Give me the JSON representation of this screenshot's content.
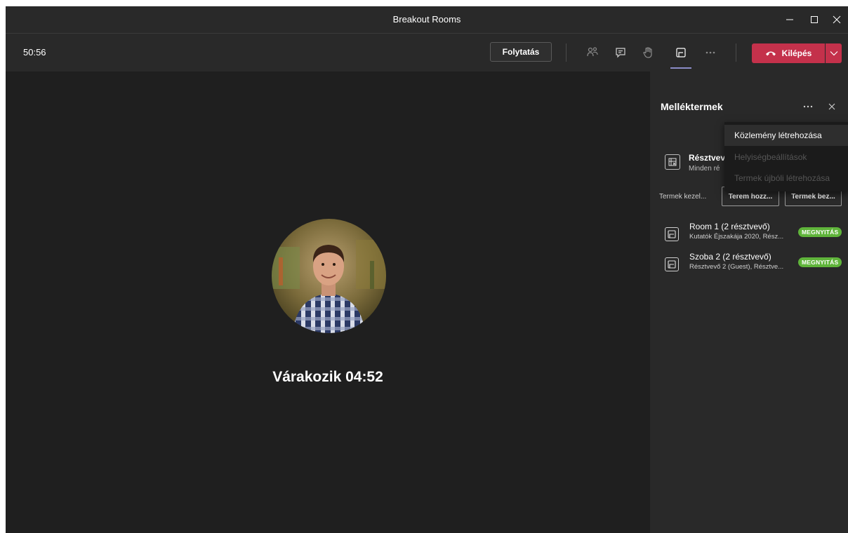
{
  "window": {
    "title": "Breakout Rooms"
  },
  "toolbar": {
    "timer": "50:56",
    "continue_label": "Folytatás",
    "leave_label": "Kilépés"
  },
  "stage": {
    "waiting_label": "Várakozik 04:52"
  },
  "panel": {
    "title": "Melléktermek",
    "participants_title": "Résztvev",
    "participants_sub": "Minden ré",
    "manage_label": "Termek kezel...",
    "add_room_label": "Terem hozz...",
    "close_rooms_label": "Termek bez...",
    "rooms": [
      {
        "name": "Room 1 (2 résztvevő)",
        "sub": "Kutatók Éjszakája 2020, Rész...",
        "badge": "MEGNYITÁS"
      },
      {
        "name": "Szoba 2 (2 résztvevő)",
        "sub": "Résztvevő 2 (Guest), Résztve...",
        "badge": "MEGNYITÁS"
      }
    ]
  },
  "menu": {
    "items": [
      {
        "label": "Közlemény létrehozása",
        "enabled": true
      },
      {
        "label": "Helyiségbeállítások",
        "enabled": false
      },
      {
        "label": "Termek újbóli létrehozása",
        "enabled": false
      }
    ]
  },
  "colors": {
    "leave": "#c4314b",
    "badge": "#5fb43a",
    "active_indicator": "#8b8cc7"
  }
}
